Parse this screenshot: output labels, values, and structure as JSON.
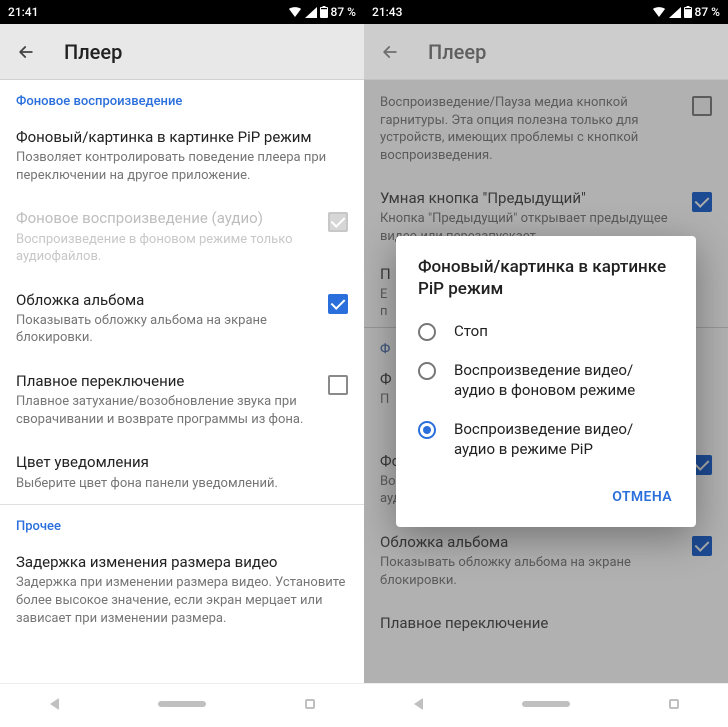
{
  "left": {
    "status": {
      "time": "21:41",
      "battery": "87 %"
    },
    "app_title": "Плеер",
    "sections": {
      "bg": {
        "header": "Фоновое воспроизведение",
        "pip": {
          "title": "Фоновый/картинка в картинке PiP режим",
          "sub": "Позволяет контролировать поведение плеера при переключении на другое приложение."
        },
        "bg_audio": {
          "title": "Фоновое воспроизведение (аудио)",
          "sub": "Воспроизведение в фоновом режиме только аудиофайлов."
        },
        "cover": {
          "title": "Обложка альбома",
          "sub": "Показывать обложку альбома на экране блокировки."
        },
        "fade": {
          "title": "Плавное переключение",
          "sub": "Плавное затухание/возобновление звука при сворачивании и возврате программы из фона."
        },
        "notif_color": {
          "title": "Цвет уведомления",
          "sub": "Выберите цвет фона панели уведомлений."
        }
      },
      "other": {
        "header": "Прочее",
        "resize_delay": {
          "title": "Задержка изменения размера видео",
          "sub": "Задержка при изменении размера видео. Установите более высокое значение, если экран мерцает или зависает при изменении размера."
        }
      }
    }
  },
  "right": {
    "status": {
      "time": "21:43",
      "battery": "87 %"
    },
    "app_title": "Плеер",
    "behind": {
      "headset": {
        "sub": "Воспроизведение/Пауза медиа кнопкой гарнитуры. Эта опция полезна только для устройств, имеющих проблемы с кнопкой воспроизведения."
      },
      "smart_prev": {
        "title": "Умная кнопка \"Предыдущий\"",
        "sub": "Кнопка \"Предыдущий\" открывает предыдущее видео или перезапускает"
      },
      "section_bg": "Ф",
      "item_f": {
        "title": "Ф",
        "sub": "П"
      },
      "item_p": {
        "title": "П",
        "sub": "Е\nп"
      },
      "bg_audio": {
        "title": "Фоновое воспроизведение (аудио)",
        "sub": "Воспроизведение в фоновом режиме только аудиофайлов."
      },
      "cover": {
        "title": "Обложка альбома",
        "sub": "Показывать обложку альбома на экране блокировки."
      },
      "fade": {
        "title": "Плавное переключение"
      }
    },
    "dialog": {
      "title": "Фоновый/картинка в картинке PiP режим",
      "options": {
        "0": "Стоп",
        "1": "Воспроизведение видео/аудио в фоновом режиме",
        "2": "Воспроизведение видео/аудио в режиме PiP"
      },
      "cancel": "ОТМЕНА"
    }
  }
}
